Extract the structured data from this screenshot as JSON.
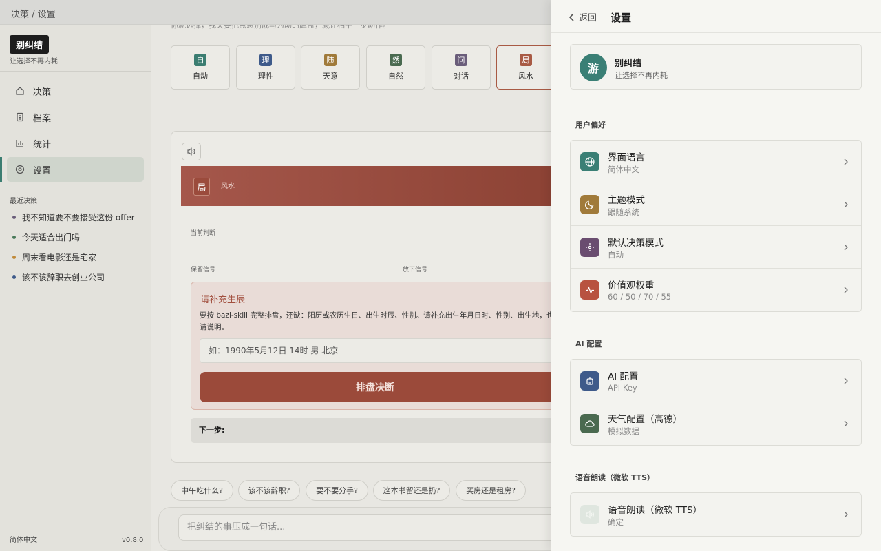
{
  "topbar": {
    "breadcrumb": "决策 / 设置"
  },
  "sidebar": {
    "brand": "别纠结",
    "tagline": "让选择不再内耗",
    "nav": [
      {
        "label": "决策",
        "icon": "home-icon"
      },
      {
        "label": "档案",
        "icon": "document-icon"
      },
      {
        "label": "统计",
        "icon": "bar-chart-icon"
      },
      {
        "label": "设置",
        "icon": "gear-icon"
      }
    ],
    "recent_title": "最近决策",
    "recent": [
      {
        "label": "我不知道要不要接受这份 offer",
        "color": "#6a5d7a"
      },
      {
        "label": "今天适合出门吗",
        "color": "#4a7a5a"
      },
      {
        "label": "周末看电影还是宅家",
        "color": "#c08a3a"
      },
      {
        "label": "该不该辞职去创业公司",
        "color": "#3e5a8a"
      }
    ],
    "footer_lang": "简体中文",
    "footer_version": "v0.8.0"
  },
  "main": {
    "faded_text": "你就选择，我关要把点悬别成与为动的虐盘，减让相平一步动作。",
    "modes": [
      {
        "badge": "自",
        "label": "自动",
        "color": "#3b7d71"
      },
      {
        "badge": "理",
        "label": "理性",
        "color": "#3e5a8a"
      },
      {
        "badge": "随",
        "label": "天意",
        "color": "#a07a3a"
      },
      {
        "badge": "然",
        "label": "自然",
        "color": "#4a6a50"
      },
      {
        "badge": "问",
        "label": "对话",
        "color": "#6a5d7a"
      },
      {
        "badge": "局",
        "label": "风水",
        "color": "#a85a44"
      }
    ],
    "result": {
      "badge": "局",
      "mode_name": "风水",
      "judgment_label": "当前判断",
      "keep_label": "保留信号",
      "drop_label": "放下信号",
      "supplement": {
        "title": "请补充生辰",
        "description": "要按 bazi-skill 完整排盘，还缺：阳历或农历生日、出生时辰、性别。请补充出生年月日时、性别、出生地，也请说明。",
        "placeholder": "如：1990年5月12日 14时 男 北京",
        "button": "排盘决断"
      },
      "next_label": "下一步:"
    },
    "chips": [
      "中午吃什么?",
      "该不该辞职?",
      "要不要分手?",
      "这本书留还是扔?",
      "买房还是租房?"
    ],
    "composer_placeholder": "把纠结的事压成一句话..."
  },
  "settings": {
    "back_label": "返回",
    "title": "设置",
    "profile": {
      "avatar": "游",
      "name": "别纠结",
      "subtitle": "让选择不再内耗"
    },
    "sections": [
      {
        "title": "用户偏好",
        "rows": [
          {
            "title": "界面语言",
            "value": "简体中文",
            "icon": "globe-icon",
            "color": "#3a7f75"
          },
          {
            "title": "主题模式",
            "value": "跟随系统",
            "icon": "moon-icon",
            "color": "#a07a3a"
          },
          {
            "title": "默认决策模式",
            "value": "自动",
            "icon": "sparkle-icon",
            "color": "#6a4d70"
          },
          {
            "title": "价值观权重",
            "value": "60 / 50 / 70 / 55",
            "icon": "pulse-icon",
            "color": "#b85240"
          }
        ]
      },
      {
        "title": "AI 配置",
        "rows": [
          {
            "title": "AI 配置",
            "value": "API Key",
            "icon": "robot-icon",
            "color": "#3e5a8a"
          },
          {
            "title": "天气配置（高德）",
            "value": "模拟数据",
            "icon": "cloud-icon",
            "color": "#4a6a50"
          }
        ]
      },
      {
        "title": "语音朗读（微软 TTS）",
        "rows": [
          {
            "title": "语音朗读（微软 TTS）",
            "value": "确定",
            "icon": "speaker-icon",
            "color": "#dfe6df"
          }
        ]
      }
    ]
  }
}
